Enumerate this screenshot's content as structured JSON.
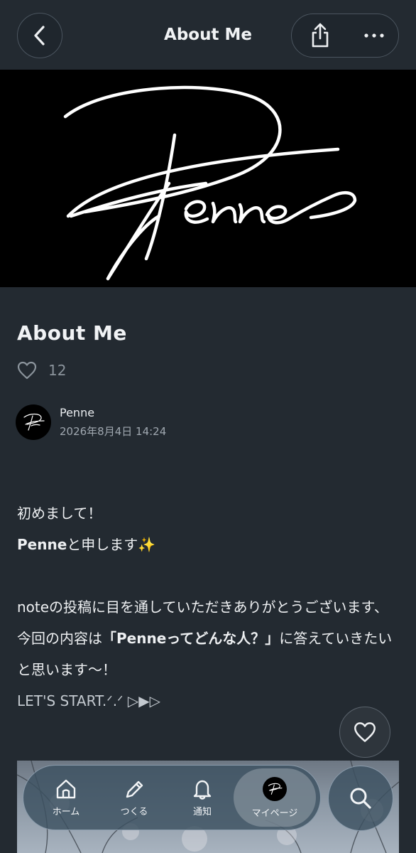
{
  "header": {
    "title": "About Me",
    "back_icon": "chevron-left-icon",
    "share_icon": "share-icon",
    "more_icon": "more-horizontal-icon"
  },
  "banner": {
    "logo_text": "Penne"
  },
  "article": {
    "title": "About Me",
    "like_count": "12",
    "author_name": "Penne",
    "date": "2026年8月4日 14:24",
    "paragraph1": "初めまして！",
    "p2_bold": "Penne",
    "p2_rest": "と申します",
    "sparkle": "✨",
    "p3_part1": "noteの投稿に目を通していただきありがとうございます、今回の内容は",
    "p3_bold": "「Penneってどんな人？」",
    "p3_part2": "に答えていきたいと思います〜！",
    "p4": "LET'S START.ᐟ.ᐟ ▷▶▷"
  },
  "nav": {
    "home": "ホーム",
    "create": "つくる",
    "notifications": "通知",
    "mypage": "マイページ"
  },
  "colors": {
    "background": "#232a31",
    "banner": "#000000",
    "text": "#e9ecef",
    "muted": "#8b949c"
  }
}
